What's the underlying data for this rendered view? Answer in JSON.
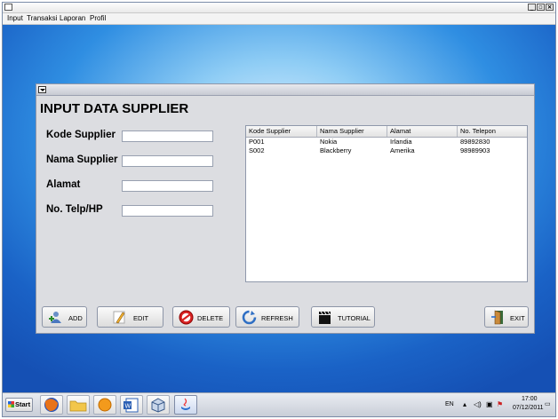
{
  "menu": [
    "Input",
    "Transaksi",
    "Laporan",
    "Profil"
  ],
  "form": {
    "title": "INPUT DATA SUPPLIER",
    "fields": [
      {
        "label": "Kode Supplier",
        "value": ""
      },
      {
        "label": "Nama Supplier",
        "value": ""
      },
      {
        "label": "Alamat",
        "value": ""
      },
      {
        "label": "No. Telp/HP",
        "value": ""
      }
    ]
  },
  "table": {
    "headers": [
      "Kode Supplier",
      "Nama Supplier",
      "Alamat",
      "No. Telepon"
    ],
    "rows": [
      [
        "P001",
        "Nokia",
        "Irlandia",
        "89892830"
      ],
      [
        "S002",
        "Blackberry",
        "Amerika",
        "98989903"
      ]
    ]
  },
  "buttons": {
    "add": "ADD",
    "edit": "EDIT",
    "delete": "DELETE",
    "refresh": "REFRESH",
    "tutorial": "TUTORIAL",
    "exit": "EXIT"
  },
  "taskbar": {
    "start": "Start",
    "language": "EN",
    "time": "17:00",
    "date": "07/12/2011"
  },
  "colors": {
    "desktop": "#2f8ee2",
    "panel": "#dcdde1"
  },
  "icons": {
    "add": "add-user-icon",
    "edit": "pencil-icon",
    "delete": "no-entry-icon",
    "refresh": "refresh-icon",
    "tutorial": "clapperboard-icon",
    "exit": "door-exit-icon"
  }
}
